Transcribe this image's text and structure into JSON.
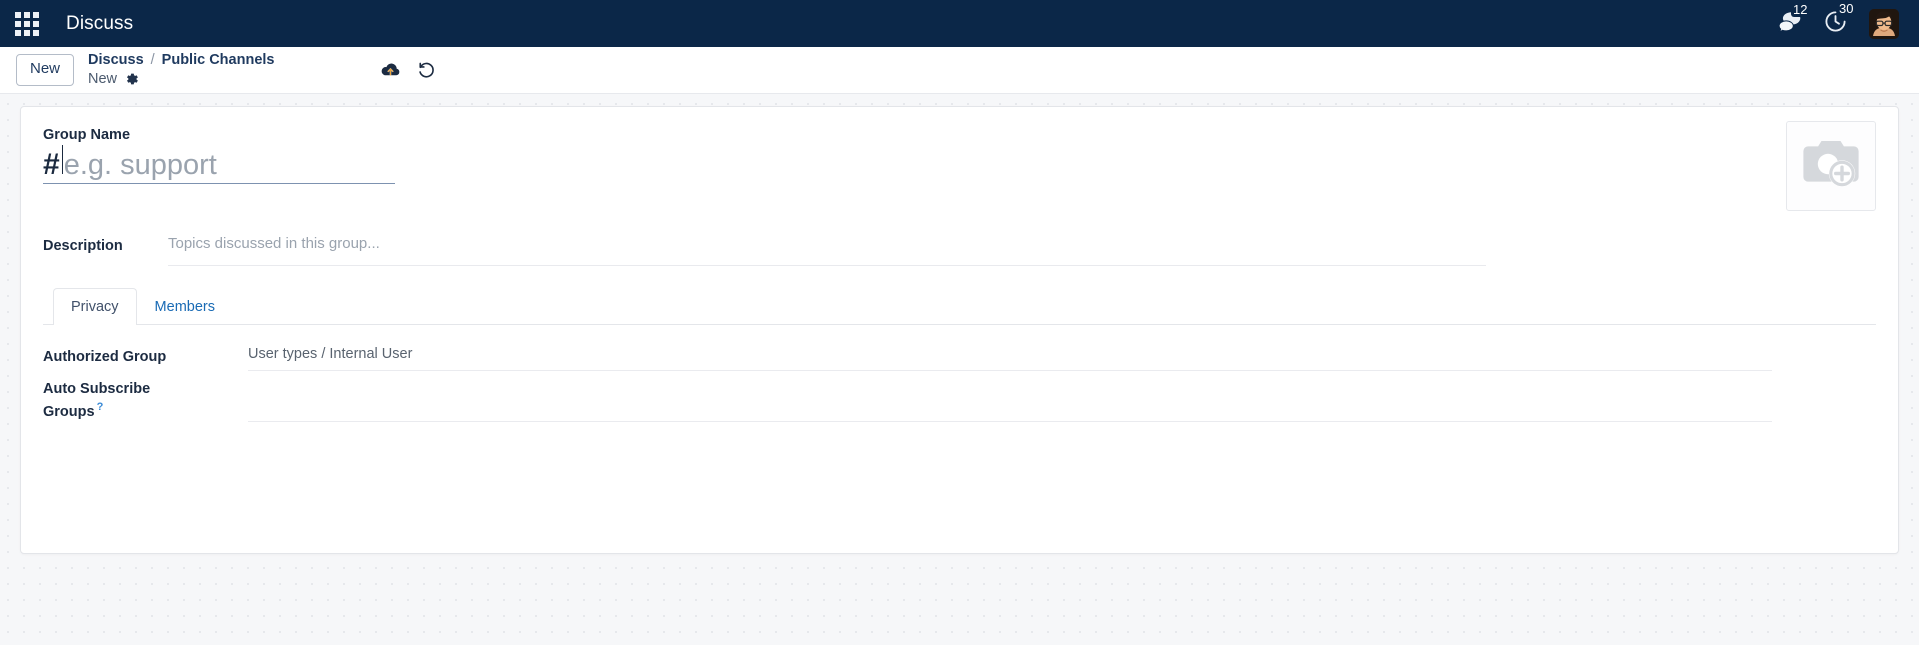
{
  "navbar": {
    "apps_icon": "apps-grid-icon",
    "brand": "Discuss",
    "messages": {
      "icon": "chat-bubbles-icon",
      "count": "12"
    },
    "activities": {
      "icon": "clock-icon",
      "count": "30"
    },
    "avatar": {
      "icon": "user-avatar"
    }
  },
  "control_panel": {
    "new_button": "New",
    "breadcrumb": {
      "root": "Discuss",
      "separator": "/",
      "parent": "Public Channels",
      "current": "New",
      "settings_icon": "gear-icon"
    },
    "actions": {
      "save": {
        "icon": "cloud-upload-icon",
        "label": "Save"
      },
      "discard": {
        "icon": "undo-arrow-icon",
        "label": "Discard"
      }
    }
  },
  "form": {
    "group_name": {
      "label": "Group Name",
      "prefix": "#",
      "placeholder": "e.g. support",
      "value": ""
    },
    "image": {
      "icon": "camera-plus-icon",
      "label": "Add image"
    },
    "description": {
      "label": "Description",
      "placeholder": "Topics discussed in this group...",
      "value": ""
    },
    "tabs": [
      {
        "label": "Privacy",
        "active": true
      },
      {
        "label": "Members",
        "active": false
      }
    ],
    "privacy_fields": [
      {
        "label": "Authorized Group",
        "value": "User types / Internal User",
        "has_help": false
      },
      {
        "label": "Auto Subscribe Groups",
        "value": "",
        "has_help": true,
        "help_icon": "question-mark-icon"
      }
    ]
  },
  "colors": {
    "navbar_bg": "#0b2748",
    "accent_link": "#1a6bb5",
    "sheet_bg": "#ffffff",
    "page_bg": "#f6f7f9",
    "text_dark": "#1c2b41",
    "placeholder": "#9aa3ae"
  }
}
